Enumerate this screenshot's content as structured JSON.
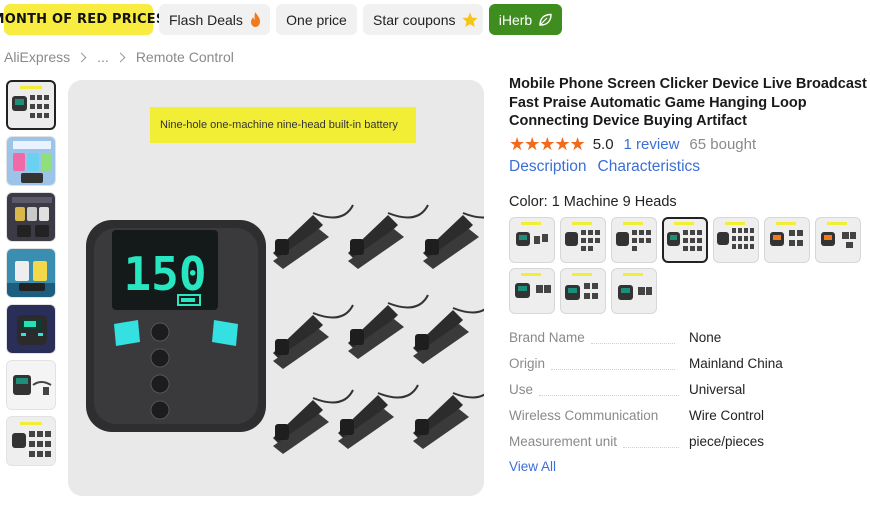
{
  "promo_pills": [
    {
      "label": "MONTH OF RED PRICES"
    },
    {
      "label": "Flash Deals",
      "icon": "fire-icon"
    },
    {
      "label": "One price"
    },
    {
      "label": "Star coupons",
      "icon": "star-icon"
    },
    {
      "label": "iHerb",
      "icon": "leaf-icon"
    }
  ],
  "breadcrumb": [
    "AliExpress",
    "...",
    "Remote Control"
  ],
  "product": {
    "title": "Mobile Phone Screen Clicker Device Live Broadcast Fast Praise Automatic Game Hanging Loop Connecting Device Buying Artifact",
    "stars": "★★★★★",
    "score": "5.0",
    "review_link": "1 review",
    "bought": "65 bought",
    "tabs": [
      "Description",
      "Characteristics"
    ],
    "color_label": "Color: 1 Machine 9 Heads",
    "image_banner": "Nine-hole one-machine nine-head built-in battery",
    "device_display": "150"
  },
  "specs": [
    {
      "key": "Brand Name",
      "value": "None"
    },
    {
      "key": "Origin",
      "value": "Mainland China"
    },
    {
      "key": "Use",
      "value": "Universal"
    },
    {
      "key": "Wireless Communication",
      "value": "Wire Control"
    },
    {
      "key": "Measurement unit",
      "value": "piece/pieces"
    }
  ],
  "view_all": "View All",
  "colors": {
    "accent_link": "#3a6fd8",
    "star": "#f26b1d",
    "iherb": "#3f8d1f",
    "promo_yellow": "#f7ec3f"
  }
}
